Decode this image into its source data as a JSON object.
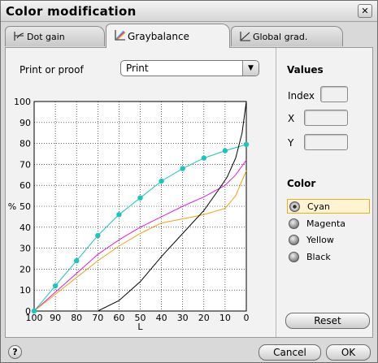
{
  "window": {
    "title": "Color modification",
    "close_glyph": "✕"
  },
  "tabs": [
    {
      "label": "Dot gain",
      "icon": "dot-gain-icon"
    },
    {
      "label": "Graybalance",
      "icon": "graybalance-icon",
      "active": true
    },
    {
      "label": "Global grad.",
      "icon": "global-gradation-icon"
    }
  ],
  "print_or_proof": {
    "label": "Print or proof",
    "selected": "Print",
    "arrow": "▼"
  },
  "values": {
    "title": "Values",
    "index_label": "Index",
    "x_label": "X",
    "y_label": "Y",
    "index_value": "",
    "x_value": "",
    "y_value": ""
  },
  "color": {
    "title": "Color",
    "selected": "Cyan",
    "options": [
      "Cyan",
      "Magenta",
      "Yellow",
      "Black"
    ]
  },
  "buttons": {
    "reset": "Reset",
    "cancel": "Cancel",
    "ok": "OK",
    "help": "?"
  },
  "colors": {
    "cyan": "#19c6be",
    "magenta": "#e01ee0",
    "yellow": "#f5a010",
    "black": "#000000"
  },
  "chart_data": {
    "type": "line",
    "xlabel": "L",
    "ylabel": "%",
    "x_ticks": [
      100,
      90,
      80,
      70,
      60,
      50,
      40,
      30,
      20,
      10,
      0
    ],
    "y_ticks": [
      0,
      10,
      20,
      30,
      40,
      50,
      60,
      70,
      80,
      90,
      100
    ],
    "xlim": [
      100,
      0
    ],
    "ylim": [
      0,
      100
    ],
    "grid": true,
    "series": [
      {
        "name": "Cyan",
        "color": "#19c6be",
        "markers": true,
        "points": [
          [
            100,
            0
          ],
          [
            90,
            12
          ],
          [
            80,
            24
          ],
          [
            70,
            36
          ],
          [
            60,
            46
          ],
          [
            50,
            54
          ],
          [
            40,
            62
          ],
          [
            30,
            68
          ],
          [
            20,
            73
          ],
          [
            10,
            76.5
          ],
          [
            0,
            79.5
          ]
        ]
      },
      {
        "name": "Magenta",
        "color": "#e01ee0",
        "markers": false,
        "points": [
          [
            100,
            0
          ],
          [
            90,
            9
          ],
          [
            80,
            18
          ],
          [
            70,
            27
          ],
          [
            60,
            34
          ],
          [
            50,
            40
          ],
          [
            40,
            45
          ],
          [
            30,
            50
          ],
          [
            20,
            54.5
          ],
          [
            10,
            60
          ],
          [
            5,
            65
          ],
          [
            0,
            72
          ]
        ]
      },
      {
        "name": "Yellow",
        "color": "#f5a010",
        "markers": false,
        "points": [
          [
            100,
            0
          ],
          [
            90,
            8
          ],
          [
            80,
            16
          ],
          [
            70,
            24
          ],
          [
            60,
            31
          ],
          [
            50,
            37
          ],
          [
            40,
            42
          ],
          [
            30,
            44
          ],
          [
            20,
            46
          ],
          [
            10,
            49
          ],
          [
            5,
            55
          ],
          [
            0,
            67
          ]
        ]
      },
      {
        "name": "Black",
        "color": "#000000",
        "markers": false,
        "points": [
          [
            70,
            0
          ],
          [
            60,
            5
          ],
          [
            50,
            14
          ],
          [
            40,
            26
          ],
          [
            30,
            37
          ],
          [
            20,
            48
          ],
          [
            13,
            58
          ],
          [
            9,
            64
          ],
          [
            5,
            73
          ],
          [
            2,
            85
          ],
          [
            0,
            100
          ]
        ]
      }
    ]
  }
}
